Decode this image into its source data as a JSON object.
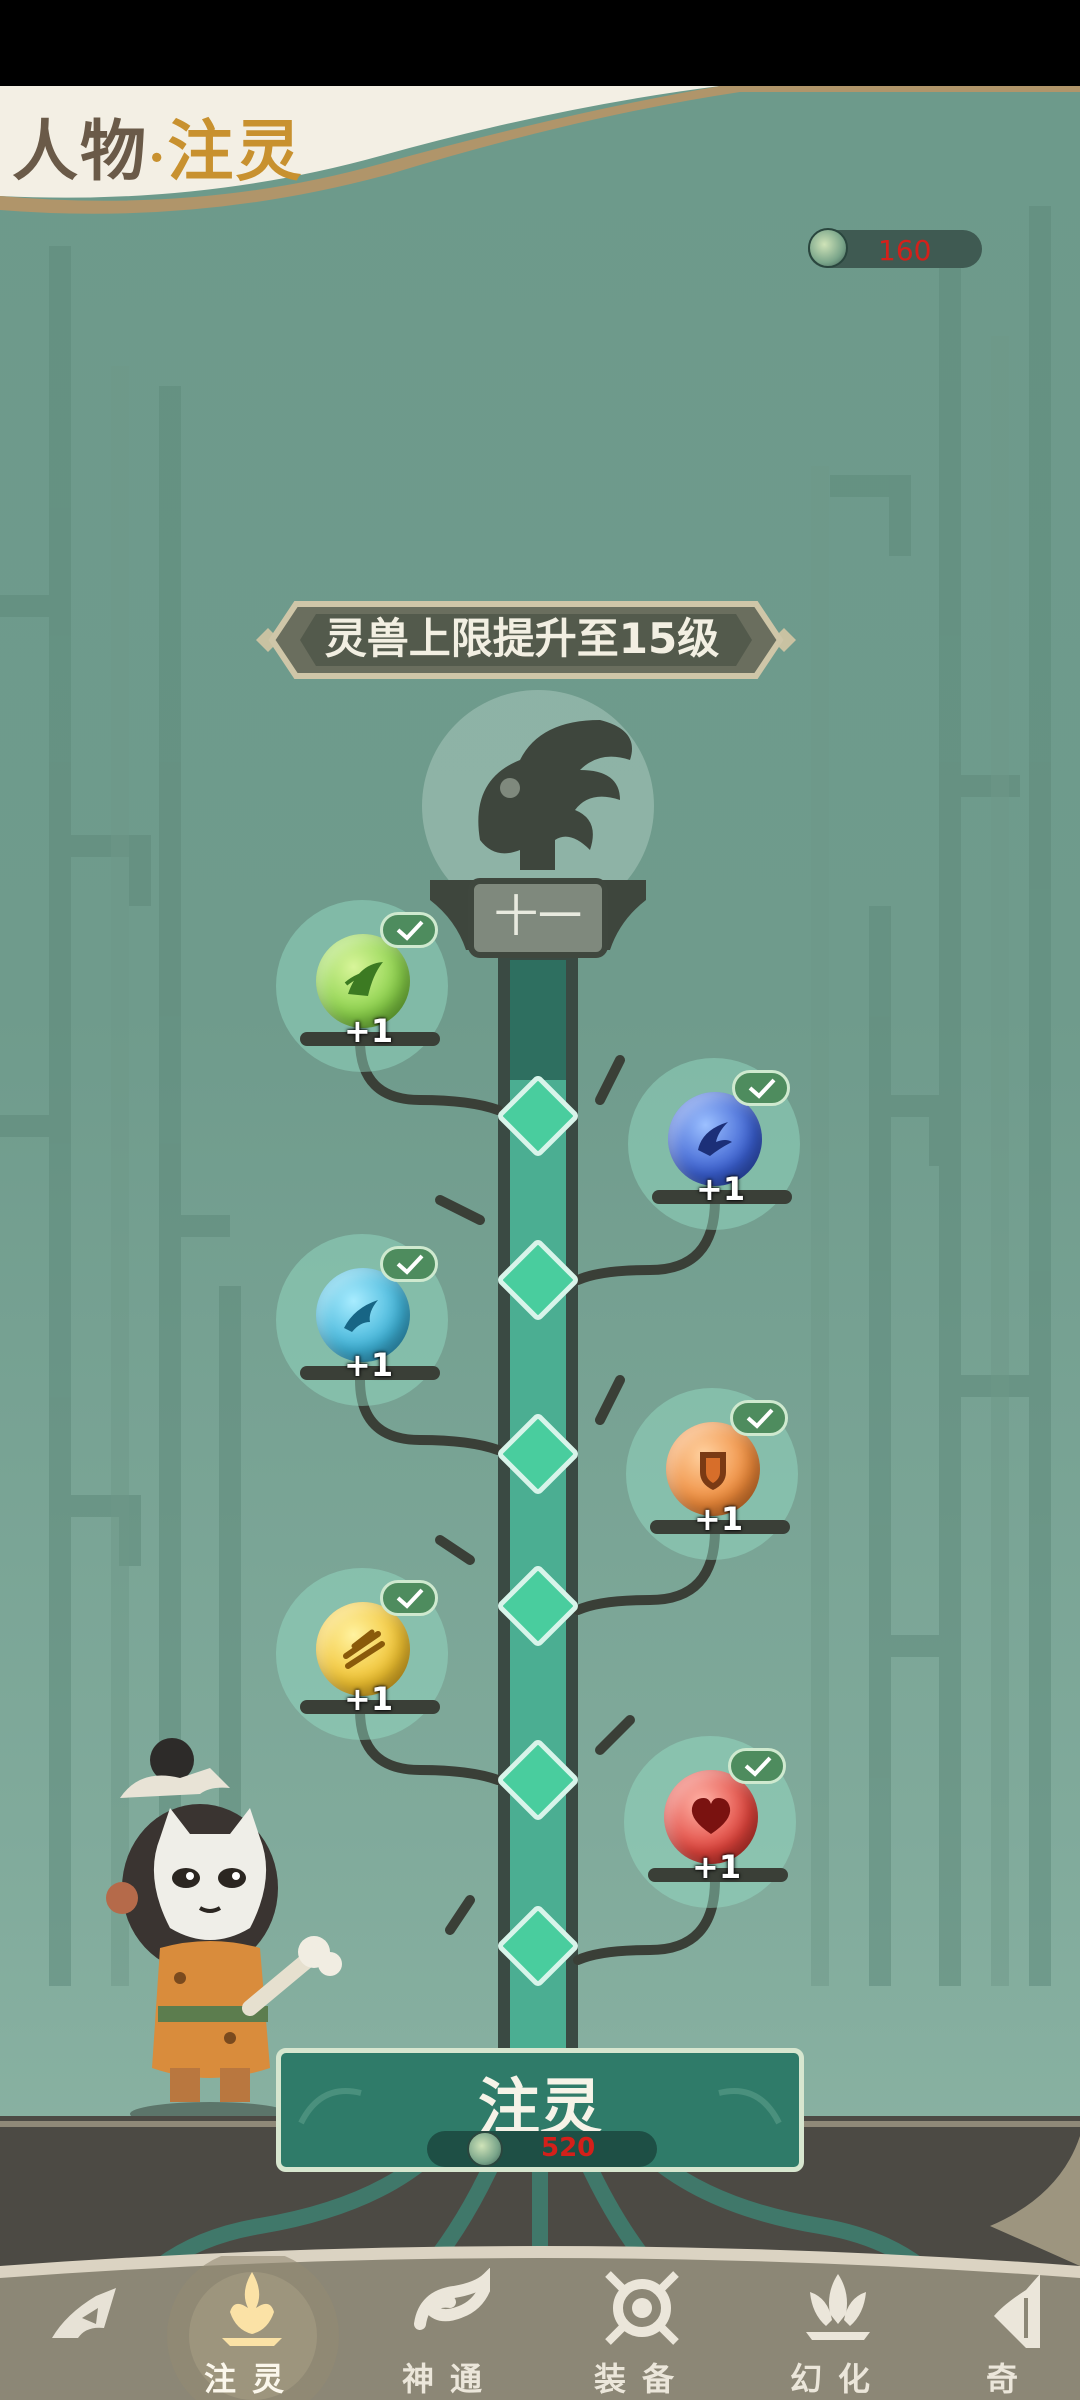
{
  "header": {
    "title_prefix": "人物",
    "title_sep": "·",
    "title_main": "注灵"
  },
  "currency": {
    "icon": "spirit-coin-icon",
    "amount": "160"
  },
  "upgrade_banner": {
    "text": "灵兽上限提升至15级"
  },
  "tree": {
    "level_label": "十一",
    "nodes": [
      {
        "name": "green-leaf-orb",
        "bonus": "+1",
        "color": "#8ad14a",
        "done": true
      },
      {
        "name": "blue-claw-orb",
        "bonus": "+1",
        "color": "#3a5fd0",
        "done": true
      },
      {
        "name": "cyan-wind-orb",
        "bonus": "+1",
        "color": "#3fb3d8",
        "done": true
      },
      {
        "name": "orange-shield-orb",
        "bonus": "+1",
        "color": "#ee8a3a",
        "done": true
      },
      {
        "name": "yellow-slash-orb",
        "bonus": "+1",
        "color": "#f1c230",
        "done": true
      },
      {
        "name": "red-heart-orb",
        "bonus": "+1",
        "color": "#e0443c",
        "done": true
      }
    ]
  },
  "inject_button": {
    "label": "注灵",
    "cost": "520"
  },
  "nav": {
    "items": [
      {
        "label": "",
        "icon": "back-claw-icon"
      },
      {
        "label": "注灵",
        "icon": "flame-lotus-icon",
        "active": true
      },
      {
        "label": "神通",
        "icon": "vortex-icon"
      },
      {
        "label": "装备",
        "icon": "armor-icon"
      },
      {
        "label": "幻化",
        "icon": "lotus-icon"
      },
      {
        "label": "奇",
        "icon": "wing-icon"
      }
    ]
  },
  "colors": {
    "accent": "#c8912f",
    "cost_red": "#d4201a",
    "gem": "#49cd9e",
    "bg": "#6f9b8c"
  }
}
